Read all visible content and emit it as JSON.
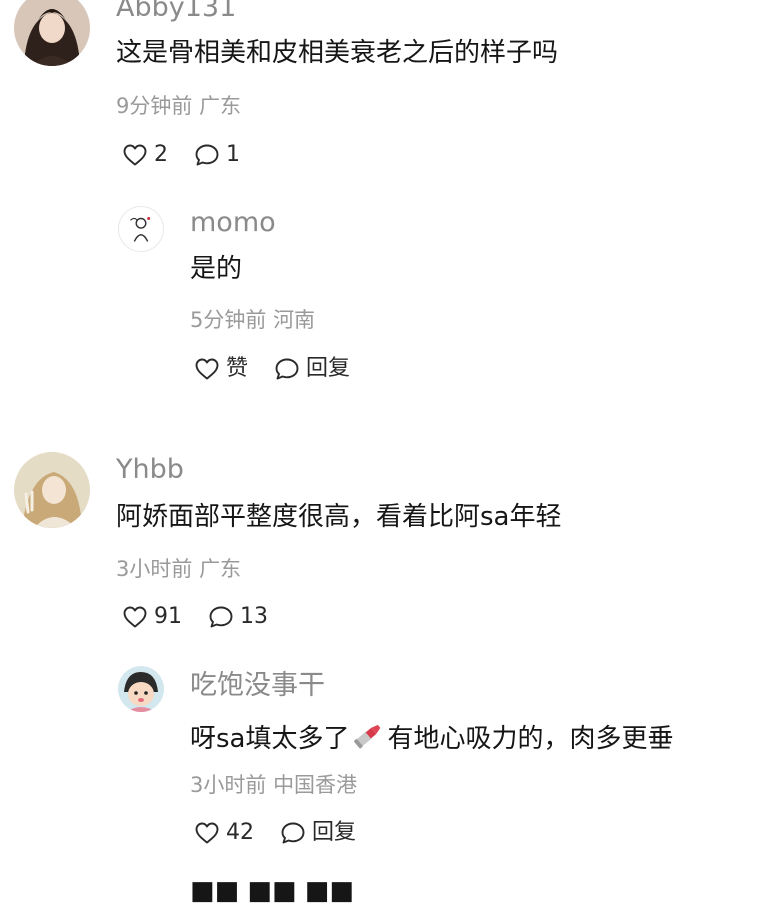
{
  "comments": [
    {
      "username": "Abby131",
      "text": "这是骨相美和皮相美衰老之后的样子吗",
      "time": "9分钟前",
      "location": "广东",
      "likes": "2",
      "replies": "1",
      "reply": {
        "username": "momo",
        "text": "是的",
        "time": "5分钟前",
        "location": "河南",
        "like_label": "赞",
        "reply_label": "回复"
      }
    },
    {
      "username": "Yhbb",
      "text": "阿娇面部平整度很高，看着比阿sa年轻",
      "time": "3小时前",
      "location": "广东",
      "likes": "91",
      "replies": "13",
      "reply": {
        "username": "吃饱没事干",
        "text_before": "呀sa填太多了",
        "emoji": "lipstick-emoji",
        "text_after": "有地心吸力的，肉多更垂",
        "time": "3小时前",
        "location": "中国香港",
        "likes": "42",
        "reply_label": "回复"
      }
    }
  ],
  "cut_off_text": "■■ ■■ ■■",
  "icons": {
    "like": "heart-outline-icon",
    "comment": "speech-bubble-icon"
  },
  "colors": {
    "name": "#8a8a8a",
    "meta": "#9a9a9a",
    "text": "#161616"
  }
}
